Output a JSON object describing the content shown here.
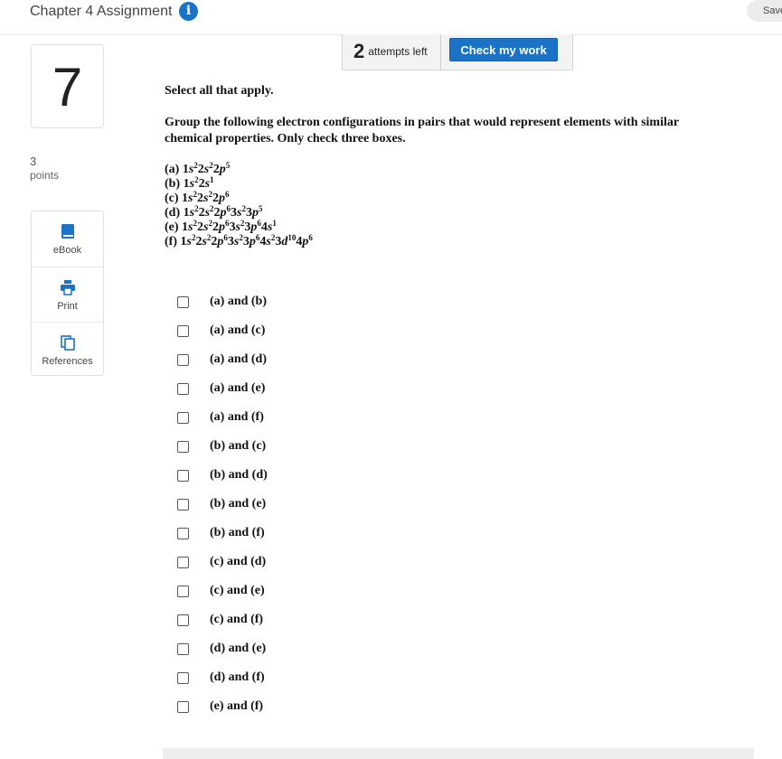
{
  "header": {
    "title": "Chapter 4 Assignment",
    "info_icon": "i",
    "save_label": "Save"
  },
  "submit_panel": {
    "attempts_count": "2",
    "attempts_label": "attempts left",
    "check_label": "Check my work"
  },
  "question_meta": {
    "number": "7",
    "points_value": "3",
    "points_label": "points"
  },
  "tools": [
    {
      "label": "eBook",
      "icon": "book-icon"
    },
    {
      "label": "Print",
      "icon": "printer-icon"
    },
    {
      "label": "References",
      "icon": "copy-icon"
    }
  ],
  "question": {
    "instruction": "Select all that apply.",
    "prompt": "Group the following electron configurations in pairs that would represent elements with similar chemical properties. Only check three boxes.",
    "configurations": [
      {
        "label": "(a)",
        "terms": [
          [
            "1",
            "s",
            "2"
          ],
          [
            "2",
            "s",
            "2"
          ],
          [
            "2",
            "p",
            "5"
          ]
        ]
      },
      {
        "label": "(b)",
        "terms": [
          [
            "1",
            "s",
            "2"
          ],
          [
            "2",
            "s",
            "1"
          ]
        ]
      },
      {
        "label": "(c)",
        "terms": [
          [
            "1",
            "s",
            "2"
          ],
          [
            "2",
            "s",
            "2"
          ],
          [
            "2",
            "p",
            "6"
          ]
        ]
      },
      {
        "label": "(d)",
        "terms": [
          [
            "1",
            "s",
            "2"
          ],
          [
            "2",
            "s",
            "2"
          ],
          [
            "2",
            "p",
            "6"
          ],
          [
            "3",
            "s",
            "2"
          ],
          [
            "3",
            "p",
            "5"
          ]
        ]
      },
      {
        "label": "(e)",
        "terms": [
          [
            "1",
            "s",
            "2"
          ],
          [
            "2",
            "s",
            "2"
          ],
          [
            "2",
            "p",
            "6"
          ],
          [
            "3",
            "s",
            "2"
          ],
          [
            "3",
            "p",
            "6"
          ],
          [
            "4",
            "s",
            "1"
          ]
        ]
      },
      {
        "label": "(f)",
        "terms": [
          [
            "1",
            "s",
            "2"
          ],
          [
            "2",
            "s",
            "2"
          ],
          [
            "2",
            "p",
            "6"
          ],
          [
            "3",
            "s",
            "2"
          ],
          [
            "3",
            "p",
            "6"
          ],
          [
            "4",
            "s",
            "2"
          ],
          [
            "3",
            "d",
            "10"
          ],
          [
            "4",
            "p",
            "6"
          ]
        ]
      }
    ],
    "options": [
      {
        "label": "(a) and (b)",
        "checked": false
      },
      {
        "label": "(a) and (c)",
        "checked": false
      },
      {
        "label": "(a) and (d)",
        "checked": false
      },
      {
        "label": "(a) and (e)",
        "checked": false
      },
      {
        "label": "(a) and (f)",
        "checked": false
      },
      {
        "label": "(b) and (c)",
        "checked": false
      },
      {
        "label": "(b) and (d)",
        "checked": false
      },
      {
        "label": "(b) and (e)",
        "checked": false
      },
      {
        "label": "(b) and (f)",
        "checked": false
      },
      {
        "label": "(c) and (d)",
        "checked": false
      },
      {
        "label": "(c) and (e)",
        "checked": false
      },
      {
        "label": "(c) and (f)",
        "checked": false
      },
      {
        "label": "(d) and (e)",
        "checked": false
      },
      {
        "label": "(d) and (f)",
        "checked": false
      },
      {
        "label": "(e) and (f)",
        "checked": false
      }
    ]
  },
  "colors": {
    "accent": "#1a73c4",
    "tool_icon": "#1a73c4"
  }
}
